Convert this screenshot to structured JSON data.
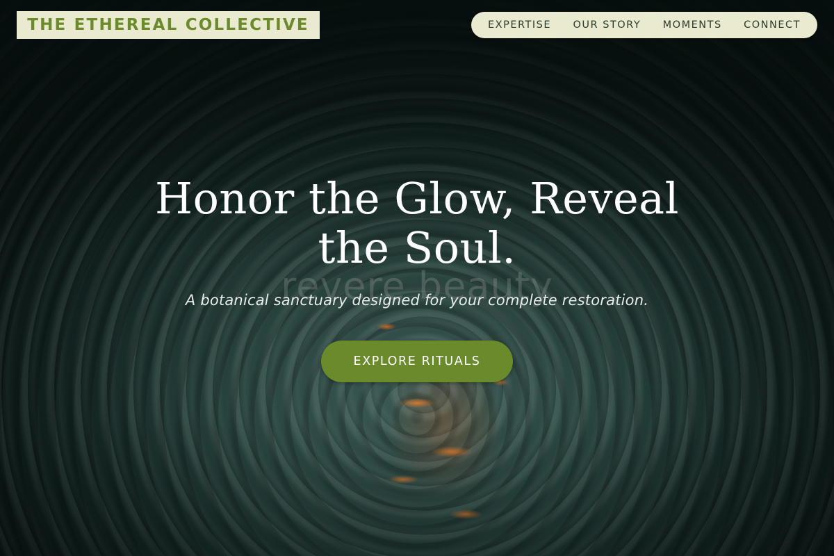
{
  "brand": {
    "name": "THE ETHEREAL COLLECTIVE",
    "color": "#6b8a2c",
    "background": "#e9eacf"
  },
  "nav": {
    "items": [
      {
        "label": "EXPERTISE"
      },
      {
        "label": "OUR STORY"
      },
      {
        "label": "MOMENTS"
      },
      {
        "label": "CONNECT"
      }
    ]
  },
  "hero": {
    "headline_line1": "Honor the Glow, Reveal",
    "headline_line2": "the Soul.",
    "watermark": "revere beauty",
    "tagline": "A botanical sanctuary designed for your complete restoration.",
    "cta_label": "EXPLORE RITUALS",
    "cta_color": "#6b8a2c",
    "background_image": "water-ripple-photo"
  }
}
